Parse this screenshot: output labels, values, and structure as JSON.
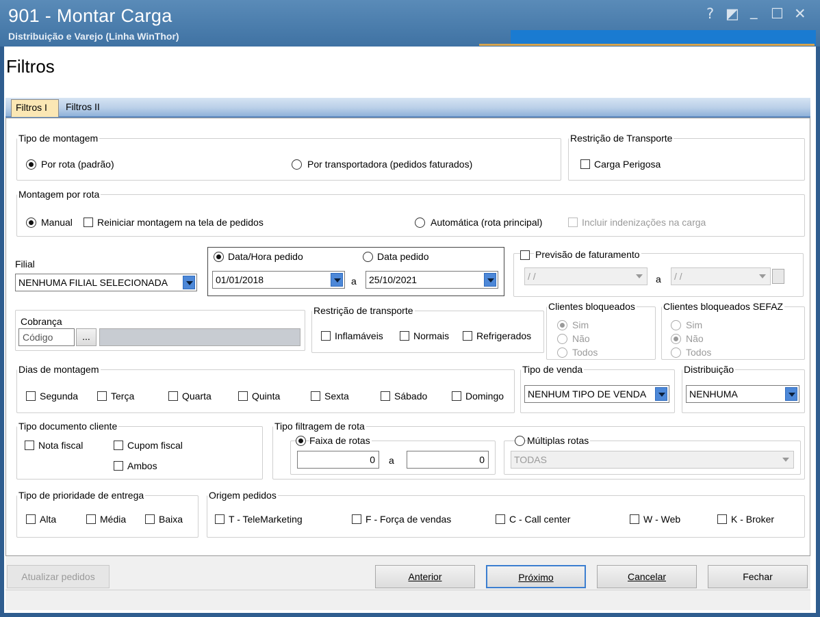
{
  "window": {
    "title": "901 - Montar Carga",
    "subtitle": "Distribuição e Varejo (Linha WinThor)",
    "controls": [
      "?",
      "◩",
      "_",
      "☐",
      "✕"
    ]
  },
  "page_heading": "Filtros",
  "tabs": [
    {
      "label": "Filtros I",
      "active": true
    },
    {
      "label": "Filtros II",
      "active": false
    }
  ],
  "tipo_montagem": {
    "legend": "Tipo de montagem",
    "por_rota": "Por rota (padrão)",
    "por_transportadora": "Por transportadora (pedidos faturados)"
  },
  "restricao_transporte_top": {
    "legend": "Restrição de Transporte",
    "carga_perigosa": "Carga Perigosa"
  },
  "montagem_rota": {
    "legend": "Montagem por rota",
    "manual": "Manual",
    "reiniciar": "Reiniciar montagem na tela de pedidos",
    "automatica": "Automática (rota principal)",
    "incluir_indenizacoes": "Incluir indenizações na carga"
  },
  "filial": {
    "label": "Filial",
    "value": "NENHUMA FILIAL SELECIONADA"
  },
  "datas": {
    "data_hora": "Data/Hora pedido",
    "data_pedido": "Data pedido",
    "start": "01/01/2018",
    "sep": "a",
    "end": "25/10/2021"
  },
  "previsao": {
    "label": "Previsão de faturamento",
    "start": "/ /",
    "sep": "a",
    "end": "/ /"
  },
  "cobranca": {
    "label": "Cobrança",
    "placeholder": "Código",
    "ellipsis": "..."
  },
  "restricao_transporte": {
    "legend": "Restrição de transporte",
    "inflamaveis": "Inflamáveis",
    "normais": "Normais",
    "refrigerados": "Refrigerados"
  },
  "clientes_bloqueados": {
    "legend": "Clientes bloqueados",
    "sim": "Sim",
    "nao": "Não",
    "todos": "Todos"
  },
  "clientes_bloqueados_sefaz": {
    "legend": "Clientes bloqueados SEFAZ",
    "sim": "Sim",
    "nao": "Não",
    "todos": "Todos"
  },
  "dias": {
    "legend": "Dias de montagem",
    "items": [
      "Segunda",
      "Terça",
      "Quarta",
      "Quinta",
      "Sexta",
      "Sábado",
      "Domingo"
    ]
  },
  "tipo_venda": {
    "legend": "Tipo de venda",
    "value": "NENHUM TIPO DE VENDA"
  },
  "distribuicao": {
    "legend": "Distribuição",
    "value": "NENHUMA"
  },
  "tipo_documento": {
    "legend": "Tipo documento cliente",
    "nota_fiscal": "Nota fiscal",
    "cupom_fiscal": "Cupom fiscal",
    "ambos": "Ambos"
  },
  "tipo_filtragem": {
    "legend": "Tipo filtragem de rota",
    "faixa": "Faixa de rotas",
    "start": "0",
    "sep": "a",
    "end": "0",
    "multiplas": "Múltiplas rotas",
    "multiplas_value": "TODAS"
  },
  "prioridade": {
    "legend": "Tipo de prioridade de  entrega",
    "alta": "Alta",
    "media": "Média",
    "baixa": "Baixa"
  },
  "origem": {
    "legend": "Origem pedidos",
    "items": [
      "T - TeleMarketing",
      "F - Força de vendas",
      "C - Call center",
      "W - Web",
      "K - Broker"
    ]
  },
  "buttons": {
    "atualizar": "Atualizar pedidos",
    "anterior": "Anterior",
    "proximo": "Próximo",
    "cancelar": "Cancelar",
    "fechar": "Fechar"
  },
  "colors": {
    "titlebar": "#4a7fb0",
    "tab_active": "#fbe7b4",
    "progress": "#1a7bd1",
    "combo_arrow": "#4d88d8"
  }
}
